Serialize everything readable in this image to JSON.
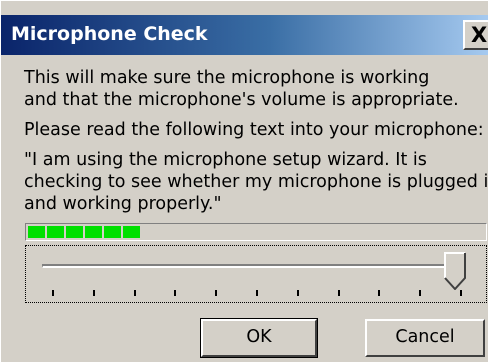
{
  "window": {
    "title": "Microphone Check",
    "close_glyph": "X"
  },
  "content": {
    "intro_line1": "This will make sure the microphone is working",
    "intro_line2": "and that the microphone's volume is appropriate.",
    "instruction": "Please read the following text into your microphone:",
    "quote_line1": "\"I am using the microphone setup wizard. It is",
    "quote_line2": "checking to see whether my microphone is plugged in",
    "quote_line3": "and working properly.\""
  },
  "level_meter": {
    "lit_segments": 6,
    "level_fraction": 0.26,
    "color": "#00e000"
  },
  "volume_slider": {
    "value_fraction": 1.0,
    "tick_count": 11
  },
  "buttons": {
    "ok_label": "OK",
    "cancel_label": "Cancel"
  }
}
